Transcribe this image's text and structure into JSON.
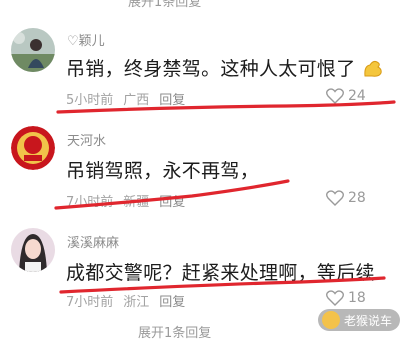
{
  "top_fragment": "展开1条回复",
  "comments": [
    {
      "username": "♡颖儿",
      "content": "吊销，终身禁驾。这种人太可恨了",
      "emoji": "flexed-arm-emoji",
      "time": "5小时前",
      "location": "广西",
      "reply_label": "回复",
      "likes": "24"
    },
    {
      "username": "天河水",
      "content": "吊销驾照，永不再驾，",
      "time": "7小时前",
      "location": "新疆",
      "reply_label": "回复",
      "likes": "28"
    },
    {
      "username": "溪溪麻麻",
      "content": "成都交警呢？赶紧来处理啊，等后续",
      "time": "7小时前",
      "location": "浙江",
      "reply_label": "回复",
      "likes": "18"
    }
  ],
  "bottom_fragment": "展开1条回复",
  "watermark": "老猴说车",
  "colors": {
    "underline": "#e0262e",
    "meta": "#a3a3a3",
    "username": "#8b8b8b"
  }
}
